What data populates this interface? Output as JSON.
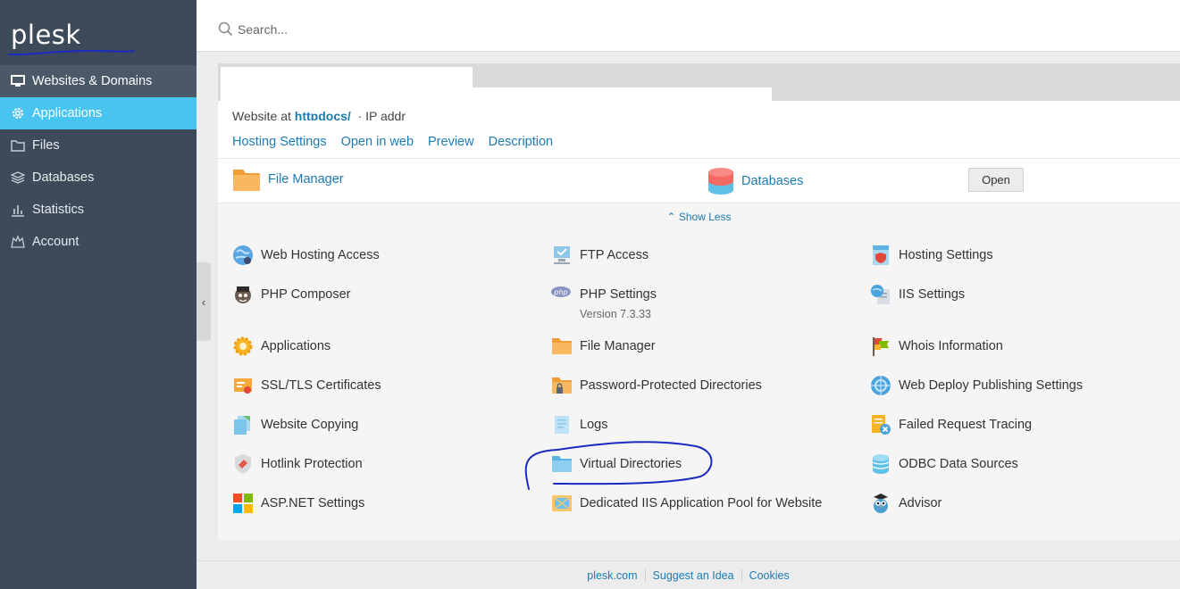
{
  "logo": {
    "text": "plesk"
  },
  "nav": {
    "items": [
      {
        "label": "Websites & Domains",
        "icon": "monitor-icon"
      },
      {
        "label": "Applications",
        "icon": "gear-icon"
      },
      {
        "label": "Files",
        "icon": "folder-icon"
      },
      {
        "label": "Databases",
        "icon": "database-stack-icon"
      },
      {
        "label": "Statistics",
        "icon": "bar-chart-icon"
      },
      {
        "label": "Account",
        "icon": "account-icon"
      }
    ]
  },
  "search": {
    "placeholder": "Search..."
  },
  "site": {
    "line_prefix": "Website at",
    "line_host": "httpdocs/",
    "line_suffix": "IP addr"
  },
  "links": [
    "Hosting Settings",
    "Open in web",
    "Preview",
    "Description"
  ],
  "quick": {
    "file_manager": "File Manager",
    "databases": "Databases",
    "open_button": "Open"
  },
  "show_less": "Show Less",
  "tools": {
    "col1": [
      "Web Hosting Access",
      "PHP Composer",
      "Applications",
      "SSL/TLS Certificates",
      "Website Copying",
      "Hotlink Protection",
      "ASP.NET Settings"
    ],
    "col2": [
      "FTP Access",
      "PHP Settings",
      "File Manager",
      "Password-Protected Directories",
      "Logs",
      "Virtual Directories",
      "Dedicated IIS Application Pool for Website"
    ],
    "col2_php_version": "Version 7.3.33",
    "col3": [
      "Hosting Settings",
      "IIS Settings",
      "Whois Information",
      "Web Deploy Publishing Settings",
      "Failed Request Tracing",
      "ODBC Data Sources",
      "Advisor"
    ]
  },
  "footer": [
    "plesk.com",
    "Suggest an Idea",
    "Cookies"
  ],
  "colors": {
    "sidebar": "#3c4a59",
    "active": "#49c4f1",
    "link": "#1b7cb4",
    "annotation": "#1a2bbf"
  }
}
